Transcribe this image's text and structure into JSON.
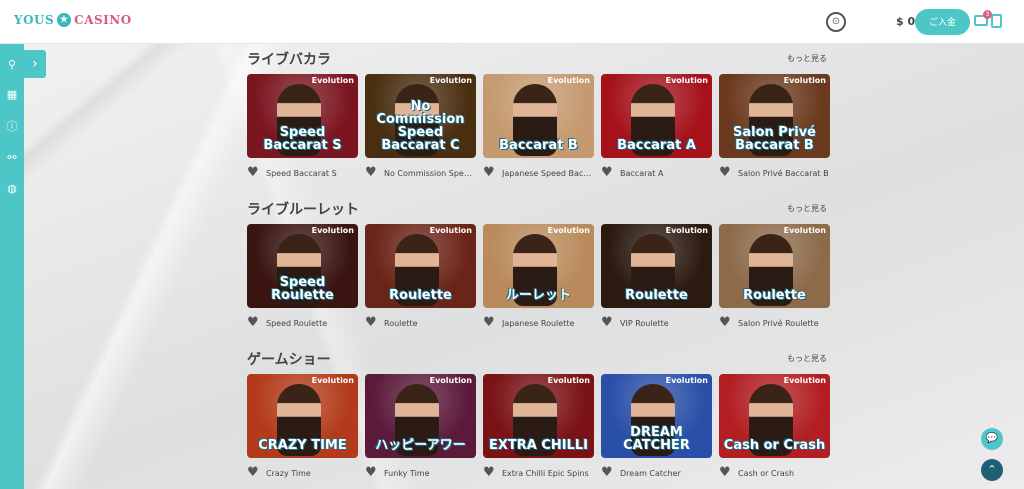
{
  "header": {
    "logo_left": "YOUS",
    "logo_star": "★",
    "logo_right": "CASINO",
    "clock_icon": "clock-icon",
    "balance": "$ 0",
    "deposit_label": "ご入金",
    "mail_badge": "3"
  },
  "sidebar": {
    "toggle": "›",
    "icons": [
      "badge-icon",
      "grid-icon",
      "info-icon",
      "link-icon",
      "globe-icon"
    ]
  },
  "sections": [
    {
      "title": "ライブバカラ",
      "more": "もっと見る",
      "games": [
        {
          "name": "Speed Baccarat S",
          "art": "Speed Baccarat S",
          "brand": "Evolution",
          "bg": "#7b1520"
        },
        {
          "name": "No Commission Speed B...",
          "art": "No Commission Speed Baccarat C",
          "brand": "Evolution",
          "bg": "#4a2e10"
        },
        {
          "name": "Japanese Speed Baccara...",
          "art": "Baccarat B",
          "brand": "Evolution",
          "bg": "#c59a70"
        },
        {
          "name": "Baccarat A",
          "art": "Baccarat A",
          "brand": "Evolution",
          "bg": "#a5121c"
        },
        {
          "name": "Salon Privé Baccarat B",
          "art": "Salon Privé Baccarat B",
          "brand": "Evolution",
          "bg": "#6b3a1e"
        }
      ]
    },
    {
      "title": "ライブルーレット",
      "more": "もっと見る",
      "games": [
        {
          "name": "Speed Roulette",
          "art": "Speed Roulette",
          "brand": "Evolution",
          "bg": "#3a1410"
        },
        {
          "name": "Roulette",
          "art": "Roulette",
          "brand": "Evolution",
          "bg": "#6b2418"
        },
        {
          "name": "Japanese Roulette",
          "art": "ルーレット",
          "brand": "Evolution",
          "bg": "#b98b5c"
        },
        {
          "name": "VIP Roulette",
          "art": "Roulette",
          "brand": "Evolution",
          "bg": "#2b1a10"
        },
        {
          "name": "Salon Privé Roulette",
          "art": "Roulette",
          "brand": "Evolution",
          "bg": "#8d6a4a"
        }
      ]
    },
    {
      "title": "ゲームショー",
      "more": "もっと見る",
      "games": [
        {
          "name": "Crazy Time",
          "art": "CRAZY TIME",
          "brand": "Evolution",
          "bg": "#b33a1a"
        },
        {
          "name": "Funky Time",
          "art": "ハッピーアワー",
          "brand": "Evolution",
          "bg": "#5b1a3a"
        },
        {
          "name": "Extra Chilli Epic Spins",
          "art": "EXTRA CHILLI",
          "brand": "Evolution",
          "bg": "#7a1216"
        },
        {
          "name": "Dream Catcher",
          "art": "DREAM CATCHER",
          "brand": "Evolution",
          "bg": "#2a4fa8"
        },
        {
          "name": "Cash or Crash",
          "art": "Cash or Crash",
          "brand": "Evolution",
          "bg": "#b21e22"
        }
      ]
    }
  ],
  "floating": {
    "chat_icon": "chat-icon",
    "top_icon": "arrow-up-icon",
    "chat_glyph": "💬",
    "top_glyph": "⌃"
  }
}
